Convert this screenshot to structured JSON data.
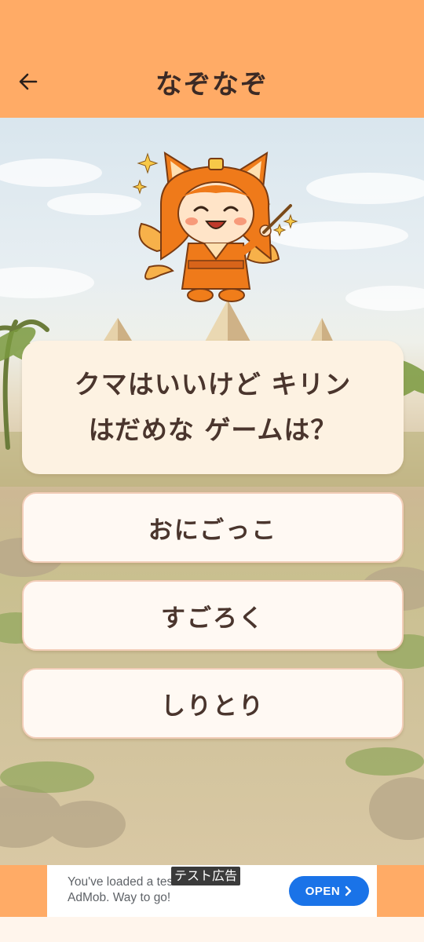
{
  "header": {
    "title": "なぞなぞ",
    "back_icon": "arrow-left-icon"
  },
  "question": {
    "line1": "クマはいいけど キリン",
    "line2": "はだめな ゲームは？"
  },
  "answers": [
    {
      "label": "おにごっこ"
    },
    {
      "label": "すごろく"
    },
    {
      "label": "しりとり"
    }
  ],
  "ad": {
    "label": "テスト広告",
    "text_line1": "You've loaded a test ad from",
    "text_line2": "AdMob. Way to go!",
    "open_label": "OPEN"
  },
  "colors": {
    "header_bg": "#ffab66",
    "card_bg": "#fdf2e2",
    "answer_bg": "#fff9f3",
    "answer_border": "#f2cdb8",
    "text": "#4a352d",
    "open_button": "#1a73e8"
  }
}
